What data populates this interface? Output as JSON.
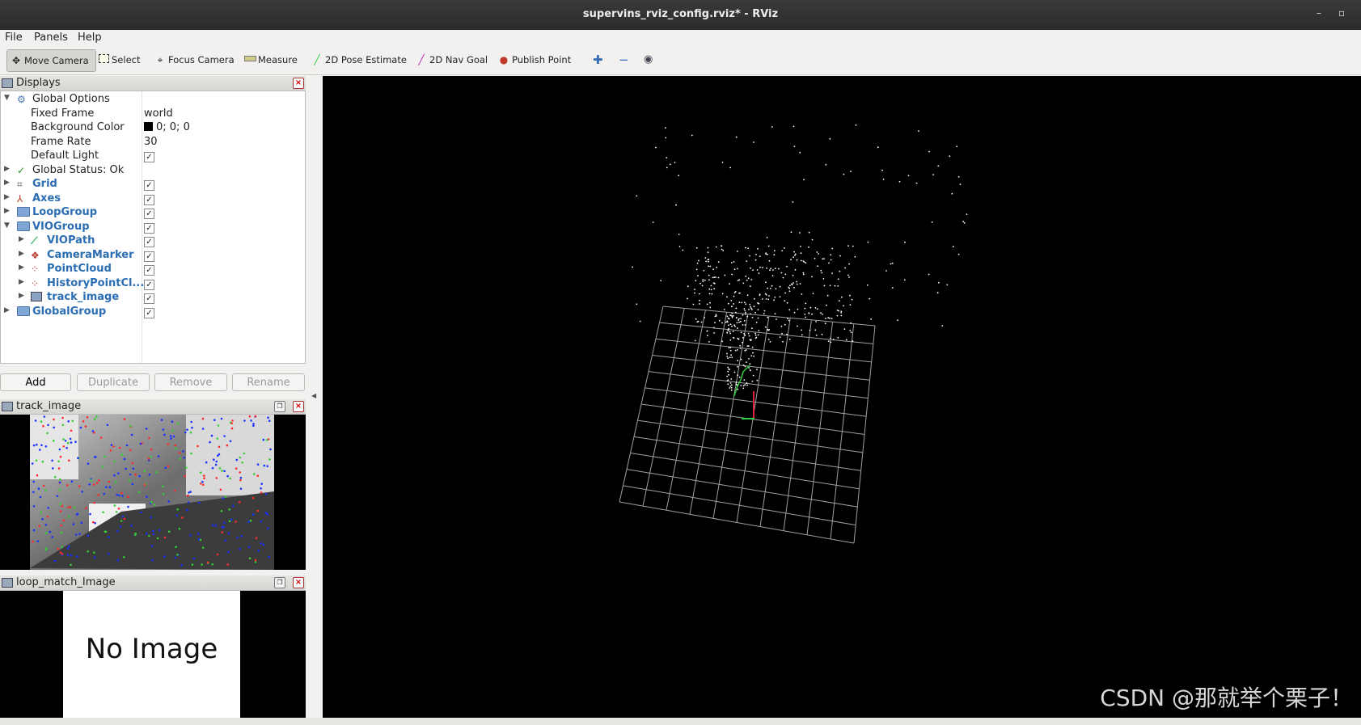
{
  "window": {
    "title": "supervins_rviz_config.rviz* - RViz",
    "minimize_glyph": "–",
    "restore_glyph": "▫"
  },
  "menu": [
    "File",
    "Panels",
    "Help"
  ],
  "toolbar": {
    "move_camera": "Move Camera",
    "select": "Select",
    "focus_camera": "Focus Camera",
    "measure": "Measure",
    "pose_estimate": "2D Pose Estimate",
    "nav_goal": "2D Nav Goal",
    "publish_point": "Publish Point"
  },
  "displays": {
    "title": "Displays",
    "global_options": "Global Options",
    "fixed_frame_label": "Fixed Frame",
    "fixed_frame_value": "world",
    "background_color_label": "Background Color",
    "background_color_value": "0; 0; 0",
    "frame_rate_label": "Frame Rate",
    "frame_rate_value": "30",
    "default_light_label": "Default Light",
    "global_status": "Global Status: Ok",
    "items": {
      "grid": "Grid",
      "axes": "Axes",
      "loop_group": "LoopGroup",
      "vio_group": "VIOGroup",
      "vio_path": "VIOPath",
      "camera_marker": "CameraMarker",
      "point_cloud": "PointCloud",
      "history_point_cloud": "HistoryPointCl...",
      "track_image": "track_image",
      "global_group": "GlobalGroup"
    },
    "buttons": {
      "add": "Add",
      "duplicate": "Duplicate",
      "remove": "Remove",
      "rename": "Rename"
    }
  },
  "track_image_panel": {
    "title": "track_image"
  },
  "loop_match_panel": {
    "title": "loop_match_Image",
    "placeholder": "No Image"
  },
  "watermark": "CSDN @那就举个栗子！",
  "colors": {
    "item_blue": "#2a6db3",
    "viewport_bg": "#000000",
    "grid_line": "#a0a0a0"
  }
}
